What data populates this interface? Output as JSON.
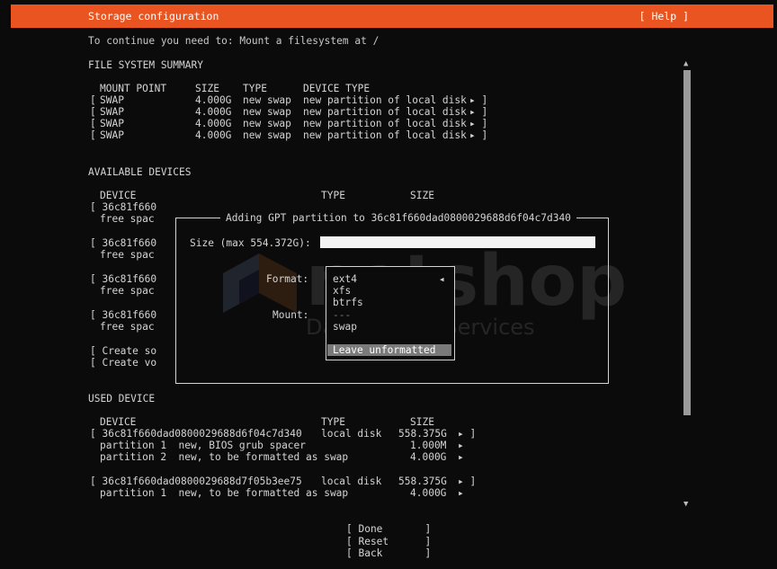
{
  "header": {
    "title": "Storage configuration",
    "help": "[ Help ]"
  },
  "instruction": "To continue you need to: Mount a filesystem at /",
  "fs_summary": {
    "heading": "FILE SYSTEM SUMMARY",
    "columns": [
      "MOUNT POINT",
      "SIZE",
      "TYPE",
      "DEVICE TYPE"
    ],
    "rows": [
      {
        "bracket": "[",
        "mount": "SWAP",
        "size": "4.000G",
        "type": "new swap",
        "device": "new partition of local disk",
        "arrow": "▸ ]"
      },
      {
        "bracket": "[",
        "mount": "SWAP",
        "size": "4.000G",
        "type": "new swap",
        "device": "new partition of local disk",
        "arrow": "▸ ]"
      },
      {
        "bracket": "[",
        "mount": "SWAP",
        "size": "4.000G",
        "type": "new swap",
        "device": "new partition of local disk",
        "arrow": "▸ ]"
      },
      {
        "bracket": "[",
        "mount": "SWAP",
        "size": "4.000G",
        "type": "new swap",
        "device": "new partition of local disk",
        "arrow": "▸ ]"
      }
    ]
  },
  "available": {
    "heading": "AVAILABLE DEVICES",
    "columns": [
      "DEVICE",
      "TYPE",
      "SIZE"
    ],
    "devices": [
      {
        "name": "[ 36c81f660",
        "sub": "free spac"
      },
      {
        "name": "[ 36c81f660",
        "sub": "free spac"
      },
      {
        "name": "[ 36c81f660",
        "sub": "free spac"
      },
      {
        "name": "[ 36c81f660",
        "sub": "free spac"
      }
    ],
    "actions": [
      "[ Create so",
      "[ Create vo"
    ]
  },
  "used": {
    "heading": "USED DEVICE",
    "columns": [
      "DEVICE",
      "TYPE",
      "SIZE"
    ],
    "disk1": {
      "name": "[ 36c81f660dad0800029688d6f04c7d340",
      "type": "local disk",
      "size": "558.375G",
      "arrow": "▸ ]"
    },
    "disk1_parts": [
      {
        "name": "partition 1  new, BIOS grub spacer",
        "size": "1.000M",
        "arrow": "▸"
      },
      {
        "name": "partition 2  new, to be formatted as swap",
        "size": "4.000G",
        "arrow": "▸"
      }
    ],
    "disk2": {
      "name": "[ 36c81f660dad0800029688d7f05b3ee75",
      "type": "local disk",
      "size": "558.375G",
      "arrow": "▸ ]"
    },
    "disk2_parts": [
      {
        "name": "partition 1  new, to be formatted as swap",
        "size": "4.000G",
        "arrow": "▸"
      }
    ]
  },
  "buttons": {
    "done": "[ Done       ]",
    "reset": "[ Reset      ]",
    "back": "[ Back       ]"
  },
  "dialog": {
    "title": "Adding GPT partition to 36c81f660dad0800029688d6f04c7d340",
    "size_label": "Size (max 554.372G):",
    "size_value": "",
    "format_label": "Format:",
    "mount_label": "Mount:",
    "format_options": [
      "ext4",
      "xfs",
      "btrfs",
      "---",
      "swap",
      "Leave unformatted"
    ],
    "selected_marker": "◂"
  },
  "watermark": {
    "brand": "netshop",
    "tagline": "Data Center Services"
  },
  "scroll": {
    "up": "▲",
    "down": "▼"
  }
}
